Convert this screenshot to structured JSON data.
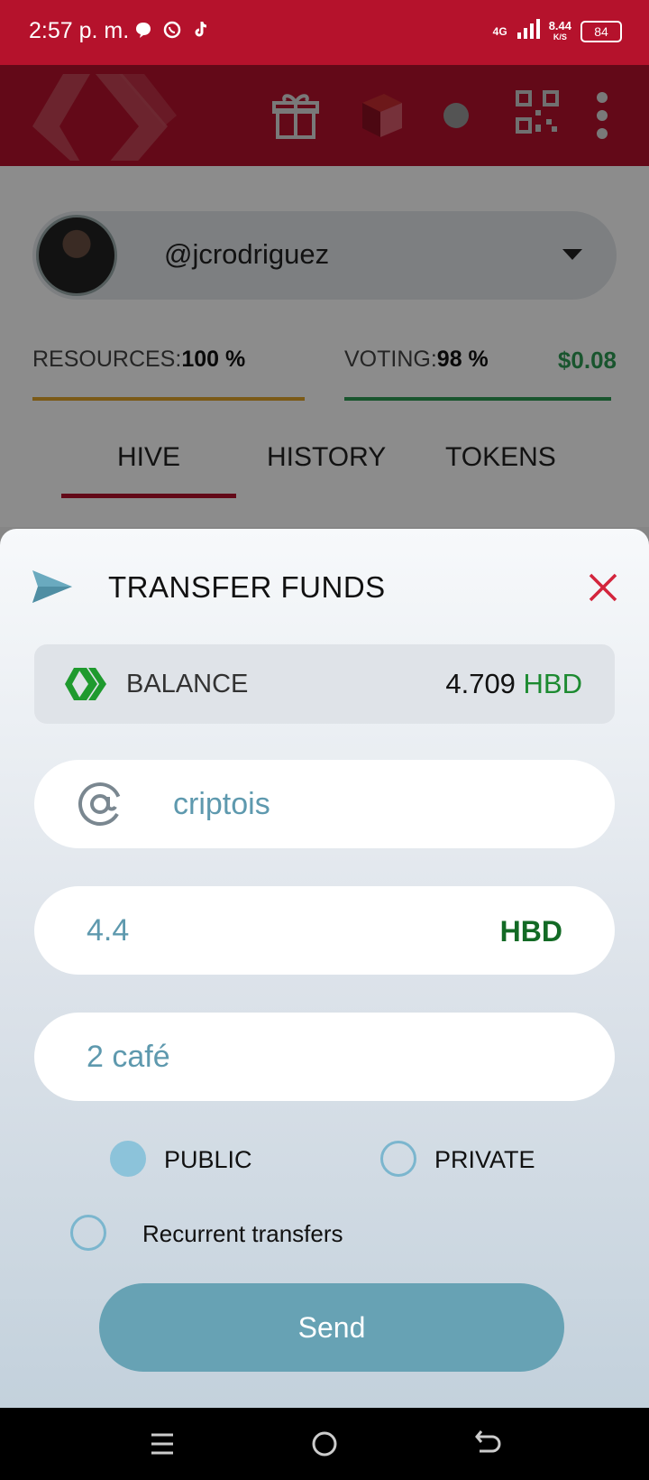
{
  "status_bar": {
    "time": "2:57 p. m.",
    "network": "4G",
    "speed_value": "8.44",
    "speed_unit": "K/S",
    "battery": "84"
  },
  "header": {
    "icons": [
      "hive-logo-icon",
      "gift-icon",
      "cube-icon",
      "dot-icon",
      "qr-code-icon",
      "more-vertical-icon"
    ]
  },
  "account": {
    "username": "@jcrodriguez"
  },
  "stats": {
    "resources_label": "RESOURCES:",
    "resources_value": "100 %",
    "voting_label": "VOTING:",
    "voting_value": "98 %",
    "voting_usd": "$0.08",
    "resources_color": "#e0a42a",
    "voting_color": "#2e9c55"
  },
  "tabs": [
    {
      "label": "HIVE"
    },
    {
      "label": "HISTORY"
    },
    {
      "label": "TOKENS"
    }
  ],
  "modal": {
    "title": "TRANSFER FUNDS",
    "balance_label": "BALANCE",
    "balance_amount": "4.709",
    "balance_currency": "HBD",
    "recipient": "criptois",
    "amount": "4.4",
    "amount_currency": "HBD",
    "memo": "2 café",
    "public_label": "PUBLIC",
    "private_label": "PRIVATE",
    "recurrent_label": "Recurrent transfers",
    "send_label": "Send"
  }
}
